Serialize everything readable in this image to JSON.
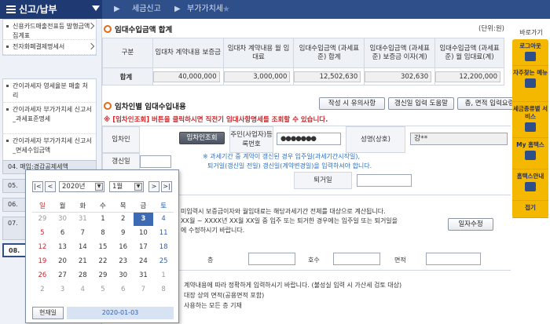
{
  "topbar": {
    "menu_title": "신고/납부",
    "crumb1": "세금신고",
    "crumb2": "부가가치세"
  },
  "sidebar": {
    "box1": [
      "신용카드매출전표등 발행금액집계표",
      "전자화폐결제명세서"
    ],
    "box2": [
      "간이과세자 영세율분 매출 처리",
      "간이과세자 부가가치세 신고서_과세표준명세",
      "간이과세자 부가가치세 신고서_면세수입금액"
    ],
    "numbered": [
      "04. 매입:경감공제세액",
      "05.",
      "06.",
      "07.",
      "08."
    ]
  },
  "summary": {
    "title": "임대수입금액 합계",
    "unit": "(단위:원)",
    "headers": [
      "구분",
      "임대차 계약내용 보증금",
      "임대차 계약내용 월 임대료",
      "임대수입금액 (과세표준) 합계",
      "임대수입금액 (과세표준) 보증금 이자(계)",
      "임대수입금액 (과세표준) 월 임대료(계)"
    ],
    "row_label": "합계",
    "values": [
      "40,000,000",
      "3,000,000",
      "12,502,630",
      "302,630",
      "12,200,000"
    ]
  },
  "detail": {
    "title": "임차인별 임대수입내용",
    "btn_caution": "작성 시 유의사항",
    "btn_renew": "갱신일 입력 도움말",
    "btn_area": "층, 면적 입력요령",
    "warning": "※ [임차인조회] 버튼을 클릭하시면 직전기 임대사항명세를 조회할 수 있습니다.",
    "tenant_label": "임차인",
    "tenant_btn": "임차인조회",
    "regno_label": "주민(사업자)등록번호",
    "regno_value": "●●●●●●●",
    "name_label": "성명(상호)",
    "name_value": "강**",
    "renew_label": "갱신일",
    "renew_note1": "※ 과세기간 중 계약이 갱신된 경우 입주일(과세기간시작일),",
    "renew_note2": "퇴거일(갱신일 전일) 갱신일(계약변경일)을 입력하셔야 합니다.",
    "exit_label": "퇴거일",
    "calc_note1": "미입력시 보증금이자와 월임대료는 해당과세기간 전체를 대상으로 계산됩니다.",
    "calc_note2": "XX월 ~ XXXX년 XX월 XX일 중 입주 또는 퇴거한 경우에는 입주일 또는 퇴거일을",
    "calc_note3": "에 수정하시기 바랍니다.",
    "btn_modify": "일자수정",
    "floor_label": "층",
    "unit_label": "호수",
    "area_label": "면적",
    "foot1": "계약내용에 따라 정확하게 입력하시기 바랍니다. (불성실 입력 시 가산세 검토 대상)",
    "foot2": "대장 상의 면적(공용면적 포함)",
    "foot3": "사용하는 모든 층 기재"
  },
  "rightbar": {
    "title": "바로가기",
    "items": [
      "로그아웃",
      "자주찾는 메뉴",
      "세금종류별 서비스",
      "My 홈택스",
      "홈택스안내",
      "접기"
    ]
  },
  "calendar": {
    "year": "2020년",
    "month": "1월",
    "weekdays": [
      "일",
      "월",
      "화",
      "수",
      "목",
      "금",
      "토"
    ],
    "weeks": [
      [
        "29",
        "30",
        "31",
        "1",
        "2",
        "3",
        "4"
      ],
      [
        "5",
        "6",
        "7",
        "8",
        "9",
        "10",
        "11"
      ],
      [
        "12",
        "13",
        "14",
        "15",
        "16",
        "17",
        "18"
      ],
      [
        "19",
        "20",
        "21",
        "22",
        "23",
        "24",
        "25"
      ],
      [
        "26",
        "27",
        "28",
        "29",
        "30",
        "31",
        "1"
      ],
      [
        "2",
        "3",
        "4",
        "5",
        "6",
        "7",
        "8"
      ]
    ],
    "today_btn": "현재일",
    "today_value": "2020-01-03"
  }
}
